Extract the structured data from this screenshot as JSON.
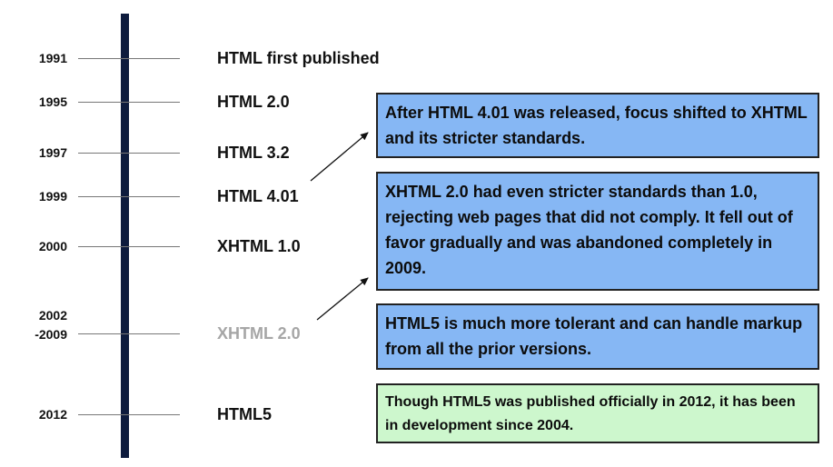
{
  "timeline": [
    {
      "year": "1991",
      "label": "HTML first published",
      "faded": false
    },
    {
      "year": "1995",
      "label": "HTML 2.0",
      "faded": false
    },
    {
      "year": "1997",
      "label": "HTML 3.2",
      "faded": false
    },
    {
      "year": "1999",
      "label": "HTML 4.01",
      "faded": false
    },
    {
      "year": "2000",
      "label": "XHTML 1.0",
      "faded": false
    },
    {
      "year": "2002\n-2009",
      "label": "XHTML 2.0",
      "faded": true
    },
    {
      "year": "2012",
      "label": "HTML5",
      "faded": false
    }
  ],
  "notes": [
    {
      "text": "After HTML 4.01 was released, focus shifted to XHTML and its stricter standards.",
      "color": "#86b7f4"
    },
    {
      "text": "XHTML 2.0 had even stricter standards than 1.0, rejecting web pages that did not comply. It fell out of favor gradually and was abandoned completely in 2009.",
      "color": "#86b7f4"
    },
    {
      "text": "HTML5 is much more tolerant and can handle markup from all the prior versions.",
      "color": "#86b7f4"
    },
    {
      "text": "Though HTML5 was published officially in 2012, it has been in development since 2004.",
      "color": "#cdf7cd"
    }
  ],
  "colors": {
    "spine": "#0d1b3d",
    "faded_label": "#a6a6a6"
  }
}
